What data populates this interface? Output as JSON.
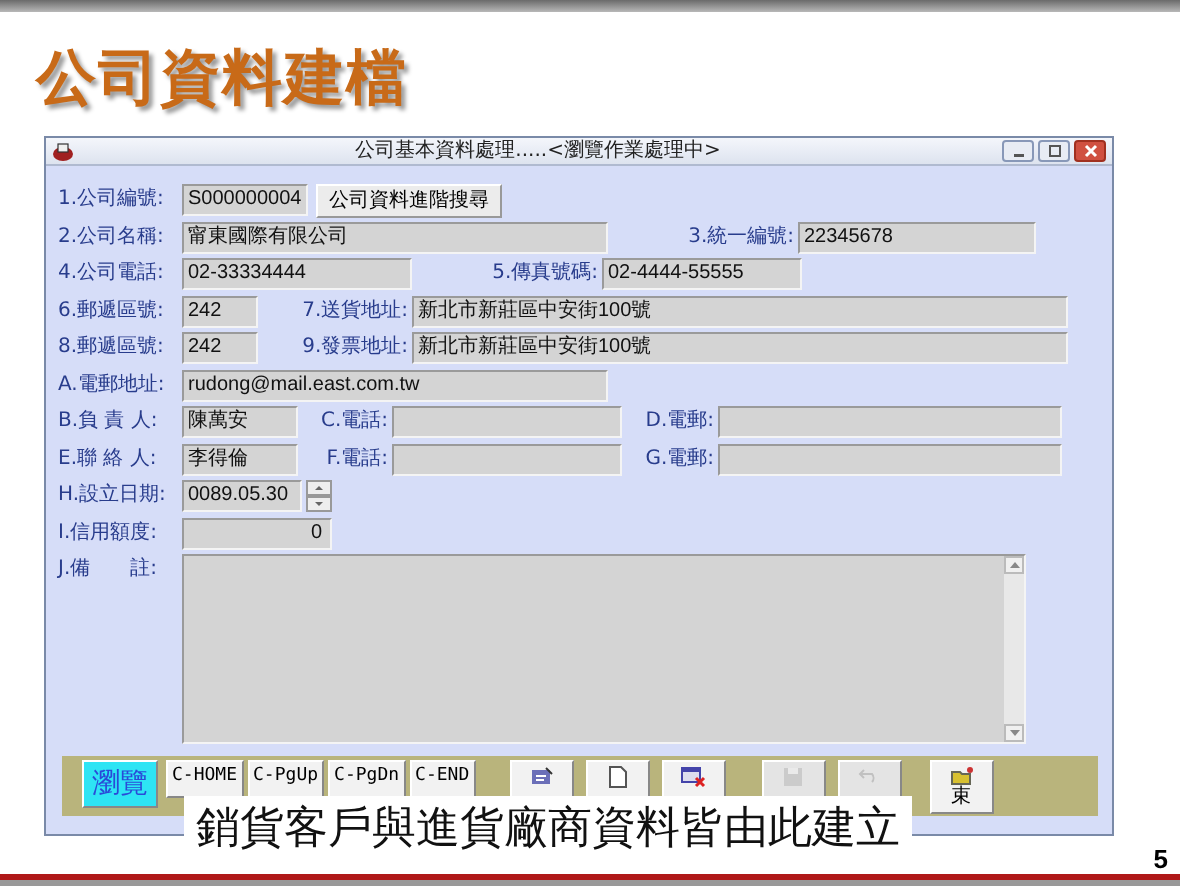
{
  "slide": {
    "title": "公司資料建檔",
    "caption": "銷貨客戶與進貨廠商資料皆由此建立",
    "page_number": "5"
  },
  "window": {
    "title": "公司基本資料處理.....<瀏覽作業處理中>"
  },
  "form_rows": [
    [
      {
        "kind": "label",
        "text": "1.公司編號:"
      },
      {
        "kind": "field",
        "value": "S000000004"
      },
      {
        "kind": "button",
        "text": "公司資料進階搜尋"
      }
    ],
    [
      {
        "kind": "label",
        "text": "2.公司名稱:"
      },
      {
        "kind": "field",
        "value": "甯東國際有限公司"
      },
      {
        "kind": "label",
        "text": "3.統一編號:"
      },
      {
        "kind": "field",
        "value": "22345678"
      }
    ],
    [
      {
        "kind": "label",
        "text": "4.公司電話:"
      },
      {
        "kind": "field",
        "value": "02-33334444"
      },
      {
        "kind": "label",
        "text": "5.傳真號碼:"
      },
      {
        "kind": "field",
        "value": "02-4444-55555"
      }
    ],
    [
      {
        "kind": "label",
        "text": "6.郵遞區號:"
      },
      {
        "kind": "field",
        "value": "242"
      },
      {
        "kind": "label",
        "text": "7.送貨地址:"
      },
      {
        "kind": "field",
        "value": "新北市新莊區中安街100號"
      }
    ],
    [
      {
        "kind": "label",
        "text": "8.郵遞區號:"
      },
      {
        "kind": "field",
        "value": "242"
      },
      {
        "kind": "label",
        "text": "9.發票地址:"
      },
      {
        "kind": "field",
        "value": "新北市新莊區中安街100號"
      }
    ],
    [
      {
        "kind": "label",
        "text": "A.電郵地址:"
      },
      {
        "kind": "field",
        "value": "rudong@mail.east.com.tw"
      }
    ],
    [
      {
        "kind": "label",
        "text": "B.負 責 人:"
      },
      {
        "kind": "field",
        "value": "陳萬安"
      },
      {
        "kind": "label",
        "text": "C.電話:"
      },
      {
        "kind": "field"
      },
      {
        "kind": "label",
        "text": "D.電郵:"
      },
      {
        "kind": "field"
      }
    ],
    [
      {
        "kind": "label",
        "text": "E.聯 絡 人:"
      },
      {
        "kind": "field",
        "value": "李得倫"
      },
      {
        "kind": "label",
        "text": "F.電話:"
      },
      {
        "kind": "field"
      },
      {
        "kind": "label",
        "text": "G.電郵:"
      },
      {
        "kind": "field"
      }
    ],
    [
      {
        "kind": "label",
        "text": "H.設立日期:"
      },
      {
        "kind": "field",
        "value": "0089.05.30"
      },
      {
        "kind": "spinner"
      }
    ],
    [
      {
        "kind": "label",
        "text": "I.信用額度:"
      },
      {
        "kind": "number",
        "value": "0"
      }
    ],
    [
      {
        "kind": "label",
        "text": "J.備　　註:"
      },
      {
        "kind": "memo"
      }
    ]
  ],
  "toolbar": [
    {
      "kind": "text",
      "label": "瀏覽",
      "selected": true
    },
    {
      "kind": "text",
      "label": "C-HOME",
      "selected": false
    },
    {
      "kind": "text",
      "label": "C-PgUp",
      "selected": false
    },
    {
      "kind": "text",
      "label": "C-PgDn",
      "selected": false
    },
    {
      "kind": "text",
      "label": "C-END",
      "selected": false
    },
    {
      "kind": "icon",
      "disabled": false
    },
    {
      "kind": "icon",
      "disabled": false
    },
    {
      "kind": "icon",
      "disabled": false
    },
    {
      "kind": "icon",
      "disabled": true
    },
    {
      "kind": "icon",
      "disabled": true
    },
    {
      "kind": "icon",
      "disabled": false,
      "label": "束"
    }
  ]
}
